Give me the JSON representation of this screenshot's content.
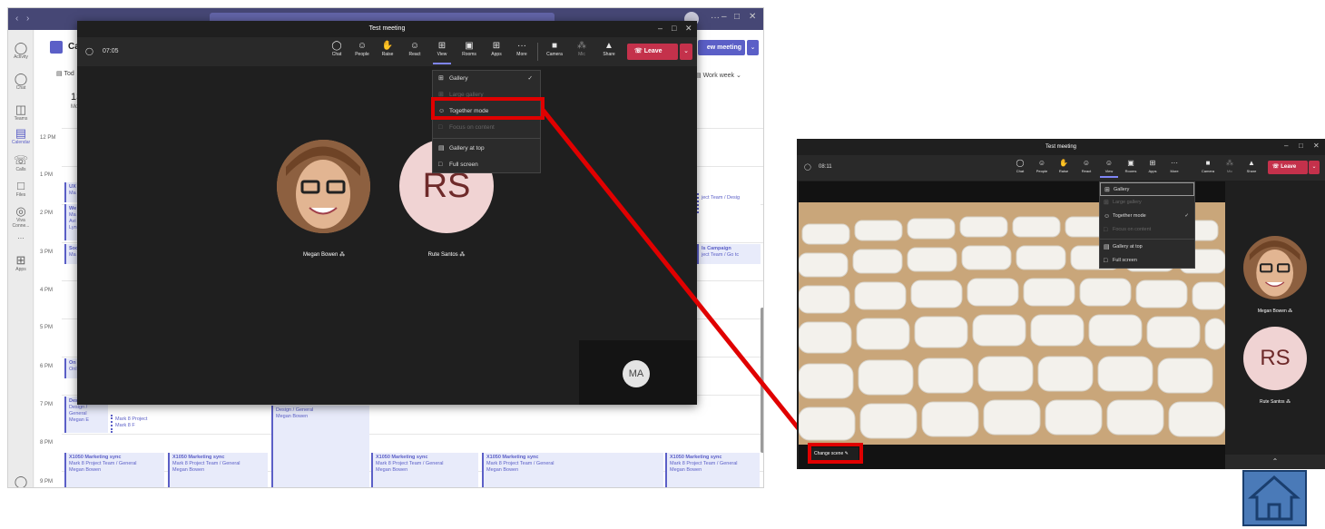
{
  "left": {
    "calendar": {
      "header_letter": "Ca",
      "today_label": "Tod",
      "date_number": "13",
      "date_sub": "Mo",
      "new_meeting_label": "ew meeting",
      "work_week_label": "Work week",
      "hours": [
        "12 PM",
        "1 PM",
        "2 PM",
        "3 PM",
        "4 PM",
        "5 PM",
        "6 PM",
        "7 PM",
        "8 PM",
        "9 PM"
      ],
      "rail": [
        {
          "label": "Activity",
          "icon": "bell-icon"
        },
        {
          "label": "Chat",
          "icon": "chat-icon"
        },
        {
          "label": "Teams",
          "icon": "teams-icon"
        },
        {
          "label": "Calendar",
          "icon": "calendar-icon"
        },
        {
          "label": "Calls",
          "icon": "phone-icon"
        },
        {
          "label": "Files",
          "icon": "file-icon"
        },
        {
          "label": "Viva Conne...",
          "icon": "viva-icon"
        },
        {
          "label": "...",
          "icon": "more-icon"
        },
        {
          "label": "Apps",
          "icon": "apps-icon"
        }
      ],
      "events": {
        "ux": "UX",
        "ux_sub": "Ma",
        "we": "We",
        "we_sub1": "Ma",
        "we_sub2": "Avi",
        "we_sub3": "Lyn",
        "so": "Soc",
        "so_sub": "Ma",
        "on": "On",
        "on_sub": "Onl",
        "de": "Des",
        "de_sub1": "Design /",
        "de_sub2": "General",
        "de_sub3": "Megan E",
        "mark8a": "Mark 8 Project",
        "mark8b": "Mark 8 F",
        "design_general": "Design / General",
        "megan_bowen": "Megan Bowen",
        "right_proj1": "ject Team / Desig",
        "right_campaign": "Is Campaign",
        "right_proj2": "ject Team / Go tc",
        "sync_title": "X1050 Marketing sync",
        "sync_team": "Mark 8 Project Team / General",
        "sync_person": "Megan Bowen"
      }
    },
    "meeting": {
      "title": "Test meeting",
      "timer": "07:05",
      "toolbar": [
        "Chat",
        "People",
        "Raise",
        "React",
        "View",
        "Rooms",
        "Apps",
        "More",
        "Camera",
        "Mic",
        "Share"
      ],
      "leave_label": "Leave",
      "view_menu": [
        "Gallery",
        "Large gallery",
        "Together mode",
        "Focus on content",
        "Gallery at top",
        "Full screen"
      ],
      "participants": [
        {
          "name": "Megan Bowen"
        },
        {
          "name": "Rute Santos",
          "initials": "RS"
        }
      ],
      "self_initials": "MA"
    }
  },
  "right": {
    "meeting": {
      "title": "Test meeting",
      "timer": "08:11",
      "toolbar": [
        "Chat",
        "People",
        "Raise",
        "React",
        "View",
        "Rooms",
        "Apps",
        "More",
        "Camera",
        "Mic",
        "Share"
      ],
      "leave_label": "Leave",
      "view_menu": [
        "Gallery",
        "Large gallery",
        "Together mode",
        "Focus on content",
        "Gallery at top",
        "Full screen"
      ],
      "change_scene_label": "Change scene",
      "participants": [
        {
          "name": "Megan Bowen"
        },
        {
          "name": "Rute Santos",
          "initials": "RS"
        }
      ]
    }
  },
  "colors": {
    "highlight": "#e00000",
    "teams_purple": "#5b5fc7",
    "leave_red": "#c4314b",
    "home_blue": "#4a7ab8"
  }
}
